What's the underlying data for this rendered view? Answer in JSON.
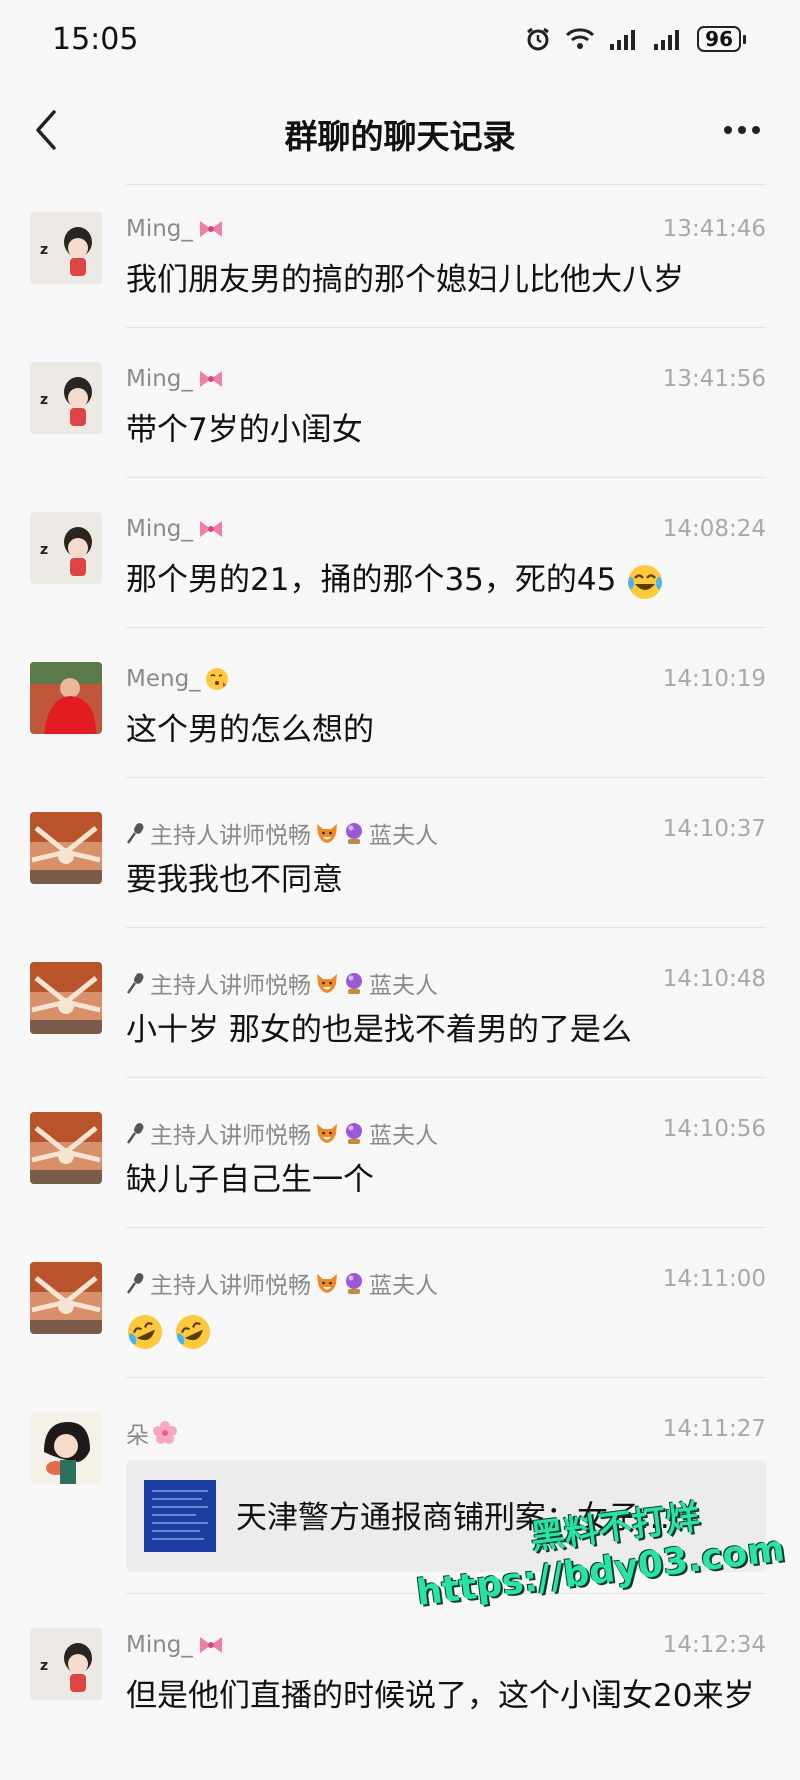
{
  "status_bar": {
    "time": "15:05",
    "battery": "96"
  },
  "nav": {
    "title": "群聊的聊天记录"
  },
  "messages": [
    {
      "sender": "Ming_",
      "sender_emoji": "ribbon-icon",
      "time": "13:41:46",
      "text": "我们朋友男的搞的那个媳妇儿比他大八岁"
    },
    {
      "sender": "Ming_",
      "sender_emoji": "ribbon-icon",
      "time": "13:41:56",
      "text": "带个7岁的小闺女"
    },
    {
      "sender": "Ming_",
      "sender_emoji": "ribbon-icon",
      "time": "14:08:24",
      "text": "那个男的21，捅的那个35，死的45"
    },
    {
      "sender": "Meng_",
      "sender_emoji": "kiss-face-icon",
      "time": "14:10:19",
      "text": "这个男的怎么想的"
    },
    {
      "sender": "主持人讲师悦畅",
      "sender_suffix": "蓝夫人",
      "time": "14:10:37",
      "text": "要我我也不同意"
    },
    {
      "sender": "主持人讲师悦畅",
      "sender_suffix": "蓝夫人",
      "time": "14:10:48",
      "text": "小十岁 那女的也是找不着男的了是么"
    },
    {
      "sender": "主持人讲师悦畅",
      "sender_suffix": "蓝夫人",
      "time": "14:10:56",
      "text": "缺儿子自己生一个"
    },
    {
      "sender": "主持人讲师悦畅",
      "sender_suffix": "蓝夫人",
      "time": "14:11:00",
      "text": ""
    },
    {
      "sender": "朵",
      "sender_emoji": "blossom-icon",
      "time": "14:11:27",
      "link_title": "天津警方通报商铺刑案：女子…"
    },
    {
      "sender": "Ming_",
      "sender_emoji": "ribbon-icon",
      "time": "14:12:34",
      "text": "但是他们直播的时候说了，这个小闺女20来岁"
    }
  ],
  "watermark": {
    "line1": "黑料不打烊",
    "line2": "https://bdy03.com"
  },
  "colors": {
    "background": "#f7f7f7",
    "divider": "#e3e3e3",
    "meta_text": "#8a8a8a",
    "watermark": "#27e3a6"
  }
}
